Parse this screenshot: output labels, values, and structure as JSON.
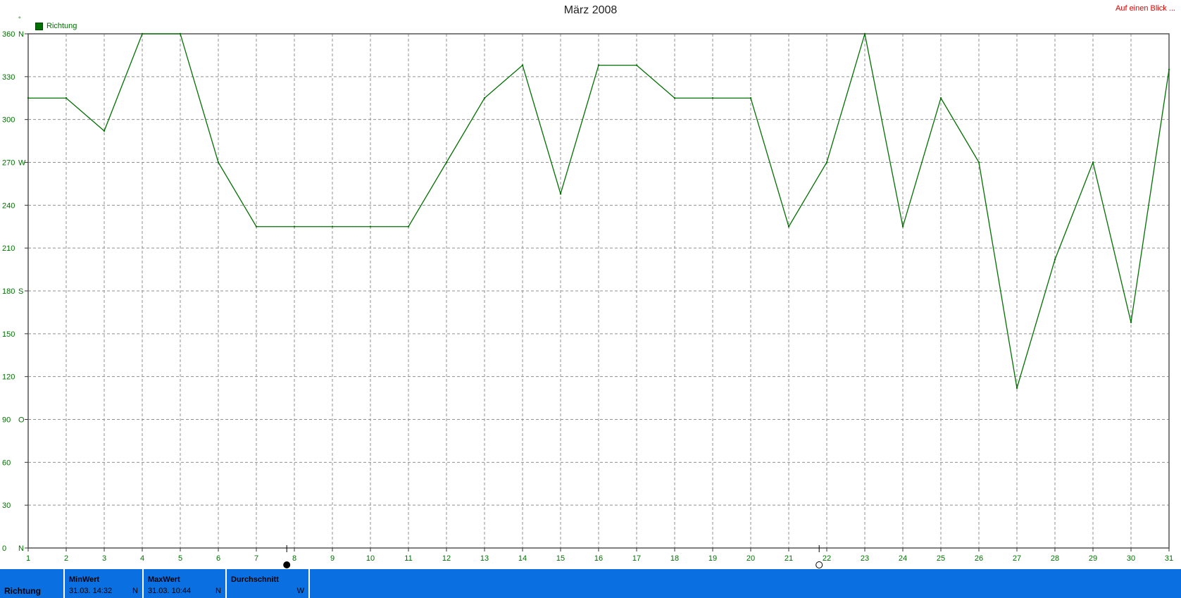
{
  "header": {
    "title": "März 2008",
    "link_label": "Auf einen Blick ..."
  },
  "colors": {
    "series": "#007000",
    "axis_text": "#007000",
    "grid": "#909090",
    "statusbar": "#0a6fe0",
    "link": "#e00000"
  },
  "chart_data": {
    "type": "line",
    "title": "März 2008",
    "xlabel": "",
    "ylabel": "",
    "xlim": [
      1,
      31
    ],
    "ylim": [
      0,
      360
    ],
    "grid": true,
    "legend_position": "top-left",
    "x_ticks": [
      "1",
      "2",
      "3",
      "4",
      "5",
      "6",
      "7",
      "8",
      "9",
      "10",
      "11",
      "12",
      "13",
      "14",
      "15",
      "16",
      "17",
      "18",
      "19",
      "20",
      "21",
      "22",
      "23",
      "24",
      "25",
      "26",
      "27",
      "28",
      "29",
      "30",
      "31"
    ],
    "y_ticks": [
      {
        "value": 0,
        "label": "0",
        "dir": "N"
      },
      {
        "value": 30,
        "label": "30",
        "dir": ""
      },
      {
        "value": 60,
        "label": "60",
        "dir": ""
      },
      {
        "value": 90,
        "label": "90",
        "dir": "O"
      },
      {
        "value": 120,
        "label": "120",
        "dir": ""
      },
      {
        "value": 150,
        "label": "150",
        "dir": ""
      },
      {
        "value": 180,
        "label": "180",
        "dir": "S"
      },
      {
        "value": 210,
        "label": "210",
        "dir": ""
      },
      {
        "value": 240,
        "label": "240",
        "dir": ""
      },
      {
        "value": 270,
        "label": "270",
        "dir": "W"
      },
      {
        "value": 300,
        "label": "300",
        "dir": ""
      },
      {
        "value": 330,
        "label": "330",
        "dir": ""
      },
      {
        "value": 360,
        "label": "360",
        "dir": "N"
      }
    ],
    "series": [
      {
        "name": "Richtung",
        "x": [
          1,
          2,
          3,
          4,
          5,
          6,
          7,
          8,
          9,
          10,
          11,
          12,
          13,
          14,
          15,
          16,
          17,
          18,
          19,
          20,
          21,
          22,
          23,
          24,
          25,
          26,
          27,
          28,
          29,
          30,
          31
        ],
        "values": [
          315,
          315,
          292,
          360,
          360,
          270,
          225,
          225,
          225,
          225,
          225,
          270,
          315,
          338,
          248,
          338,
          338,
          315,
          315,
          315,
          225,
          270,
          360,
          225,
          315,
          270,
          112,
          202,
          270,
          158,
          335
        ]
      }
    ],
    "markers": [
      {
        "x": 7.8,
        "type": "full-moon"
      },
      {
        "x": 21.8,
        "type": "new-moon"
      }
    ]
  },
  "statusbar": {
    "name": "Richtung",
    "min": {
      "label": "MinWert",
      "value": "31.03.  14:32",
      "dir": "N"
    },
    "max": {
      "label": "MaxWert",
      "value": "31.03.  10:44",
      "dir": "N"
    },
    "avg": {
      "label": "Durchschnitt",
      "value": "",
      "dir": "W"
    }
  }
}
